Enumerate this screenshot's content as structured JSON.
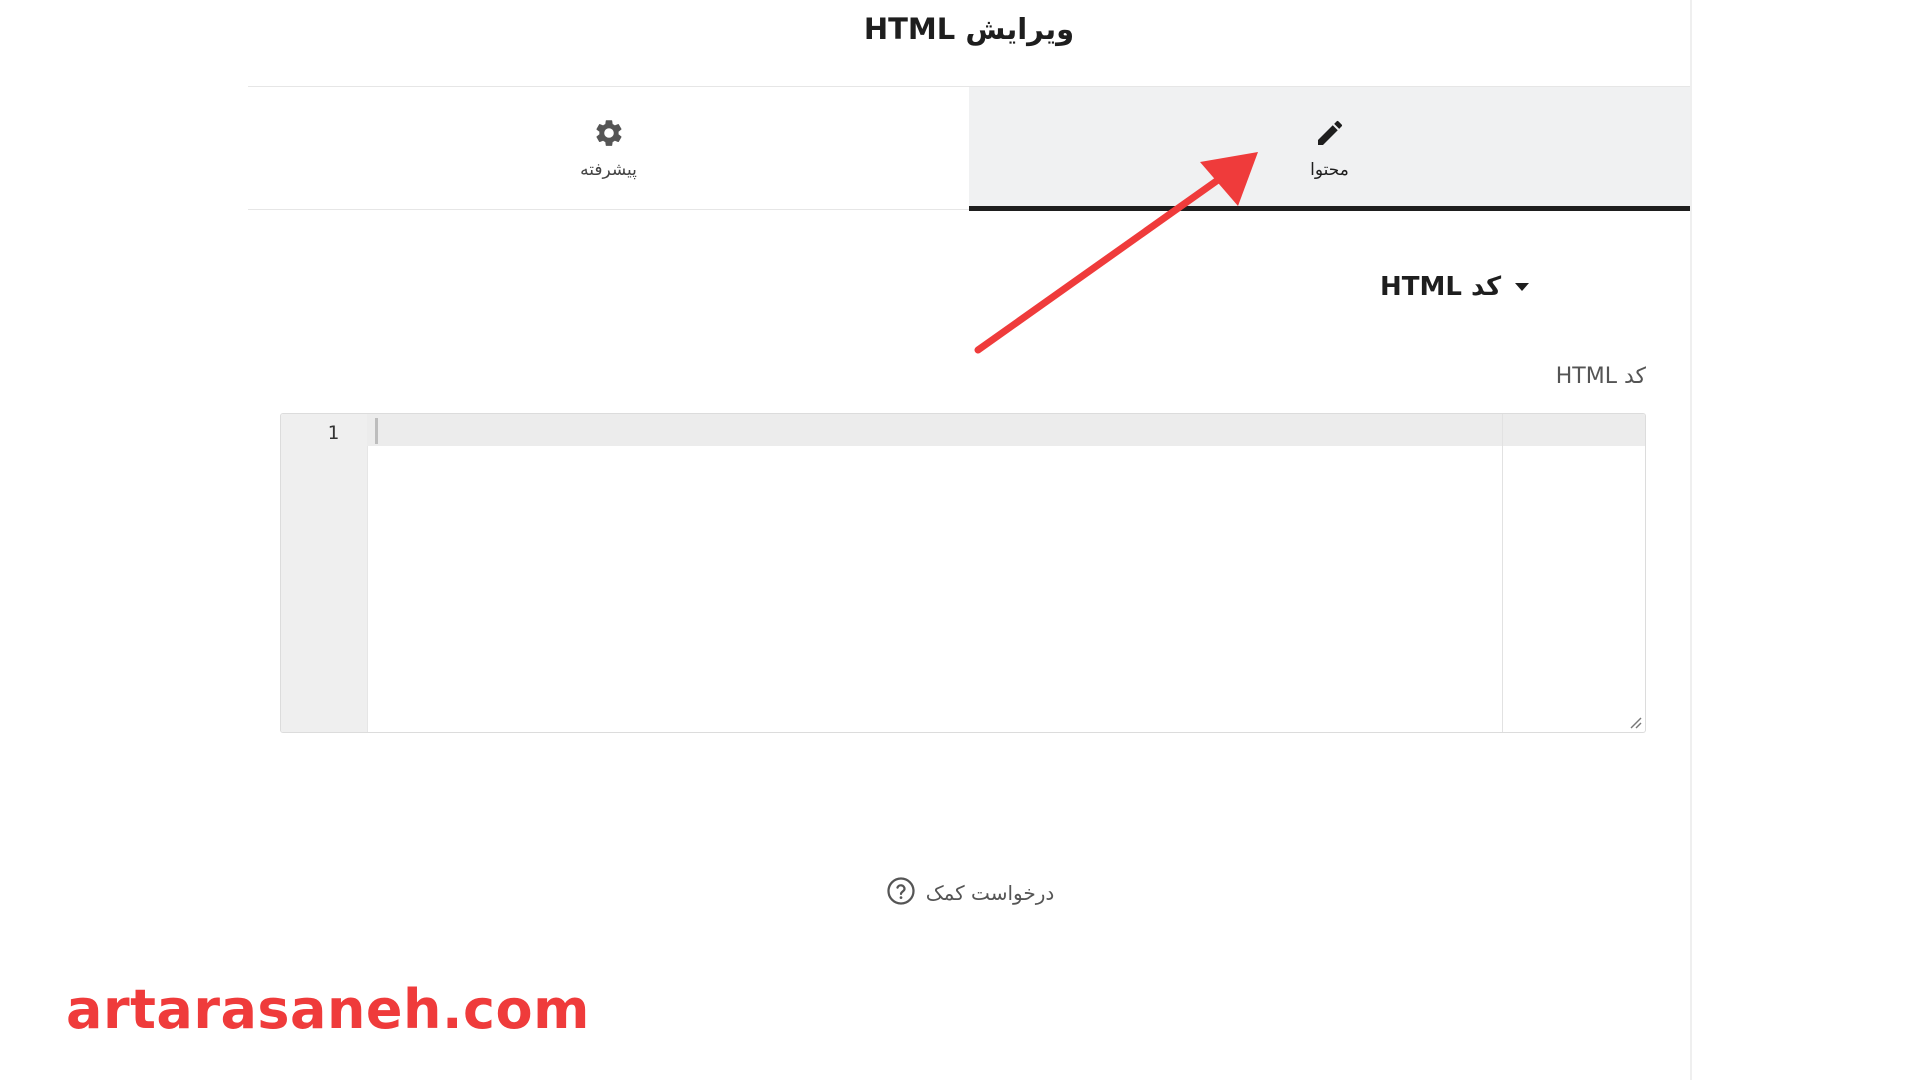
{
  "panel": {
    "title": "ویرایش HTML"
  },
  "tabs": [
    {
      "label": "پیشرفته",
      "icon": "gear-icon",
      "active": false
    },
    {
      "label": "محتوا",
      "icon": "pencil-icon",
      "active": true
    }
  ],
  "section": {
    "title": "کد HTML",
    "collapsed": false
  },
  "field": {
    "label": "کد HTML",
    "line_number": "1",
    "value": ""
  },
  "help": {
    "label": "درخواست کمک",
    "icon": "question-circle-icon"
  },
  "watermark": {
    "text": "artarasaneh.com"
  },
  "colors": {
    "accent_dark": "#1e1e1e",
    "active_tab_bg": "#f0f1f2",
    "annotation_red": "#ef3b3b"
  }
}
